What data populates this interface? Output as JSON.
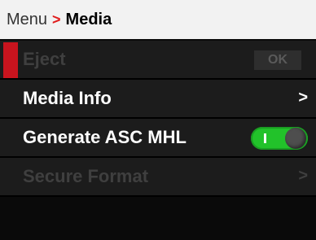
{
  "breadcrumb": {
    "parent": "Menu",
    "separator": ">",
    "current": "Media"
  },
  "menu": {
    "items": [
      {
        "label": "Eject",
        "state": "disabled",
        "selected": true,
        "action_label": "OK"
      },
      {
        "label": "Media Info",
        "state": "enabled",
        "chevron": ">"
      },
      {
        "label": "Generate ASC MHL",
        "state": "enabled",
        "toggle": "on"
      },
      {
        "label": "Secure Format",
        "state": "disabled",
        "chevron": ">"
      }
    ]
  },
  "colors": {
    "accent_red": "#c8141e",
    "toggle_on": "#22c22a",
    "header_bg": "#f2f2f2",
    "row_bg": "#1c1c1c",
    "disabled_text": "#3f3f3f"
  },
  "icons": {
    "breadcrumb_separator": "chevron-right-icon",
    "submenu": "chevron-right-icon"
  }
}
